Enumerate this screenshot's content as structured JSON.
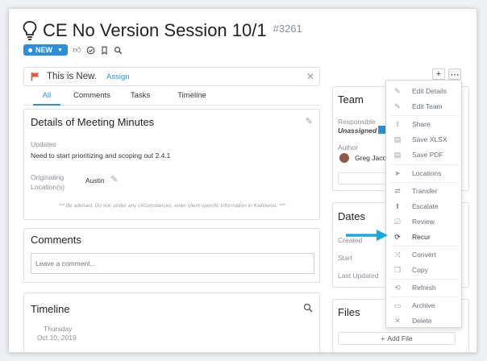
{
  "header": {
    "title": "CE No Version Session 10/1",
    "item_id": "#3261",
    "status_label": "NEW"
  },
  "banner": {
    "text": "This is New.",
    "assign_label": "Assign"
  },
  "tabs": [
    {
      "label": "All",
      "active": true
    },
    {
      "label": "Comments",
      "active": false
    },
    {
      "label": "Tasks",
      "active": false
    },
    {
      "label": "Timeline",
      "active": false
    }
  ],
  "details": {
    "title": "Details of Meeting Minutes",
    "updates_label": "Updates",
    "updates_text": "Need to start prioritizing and scoping out 2.4.1",
    "location_label": "Originating Location(s)",
    "location_value": "Austin",
    "advisory": "*** Be advised: Do not, under any circumstances, enter client-specific information in KaiNexus. ***"
  },
  "comments": {
    "title": "Comments",
    "placeholder": "Leave a comment..."
  },
  "timeline": {
    "title": "Timeline",
    "weekday": "Thursday",
    "date": "Oct 10, 2019"
  },
  "team": {
    "title": "Team",
    "responsible_label": "Responsible",
    "responsible_value": "Unassigned",
    "author_label": "Author",
    "author_name": "Greg Jaco"
  },
  "dates": {
    "title": "Dates",
    "created_label": "Created",
    "start_label": "Start",
    "last_updated_label": "Last Updated"
  },
  "files": {
    "title": "Files",
    "add_label": "Add File"
  },
  "menu": {
    "items": [
      {
        "label": "Edit Details",
        "icon": "pencil-icon",
        "glyph": "✎",
        "dark": false
      },
      {
        "label": "Edit Team",
        "icon": "pencil-icon",
        "glyph": "✎",
        "dark": false
      },
      {
        "label": "Share",
        "icon": "share-icon",
        "glyph": "⇪",
        "dark": false
      },
      {
        "label": "Save XLSX",
        "icon": "xlsx-file-icon",
        "glyph": "▤",
        "dark": false
      },
      {
        "label": "Save PDF",
        "icon": "pdf-file-icon",
        "glyph": "▤",
        "dark": false
      },
      {
        "label": "Locations",
        "icon": "location-arrow-icon",
        "glyph": "➤",
        "dark": false
      },
      {
        "label": "Transfer",
        "icon": "transfer-icon",
        "glyph": "⇄",
        "dark": false
      },
      {
        "label": "Escalate",
        "icon": "escalate-icon",
        "glyph": "⬆",
        "dark": false
      },
      {
        "label": "Review",
        "icon": "review-icon",
        "glyph": "☑",
        "dark": false
      },
      {
        "label": "Recur",
        "icon": "recur-icon",
        "glyph": "⟳",
        "dark": true
      },
      {
        "label": "Convert",
        "icon": "convert-icon",
        "glyph": "⤨",
        "dark": false
      },
      {
        "label": "Copy",
        "icon": "copy-icon",
        "glyph": "❐",
        "dark": false
      },
      {
        "label": "Refresh",
        "icon": "refresh-icon",
        "glyph": "⟲",
        "dark": false
      },
      {
        "label": "Archive",
        "icon": "archive-icon",
        "glyph": "▭",
        "dark": false
      },
      {
        "label": "Delete",
        "icon": "delete-icon",
        "glyph": "✕",
        "dark": false
      }
    ]
  },
  "colors": {
    "accent": "#2f8ed8",
    "flag": "#e05a47",
    "arrow": "#19a9e1"
  }
}
